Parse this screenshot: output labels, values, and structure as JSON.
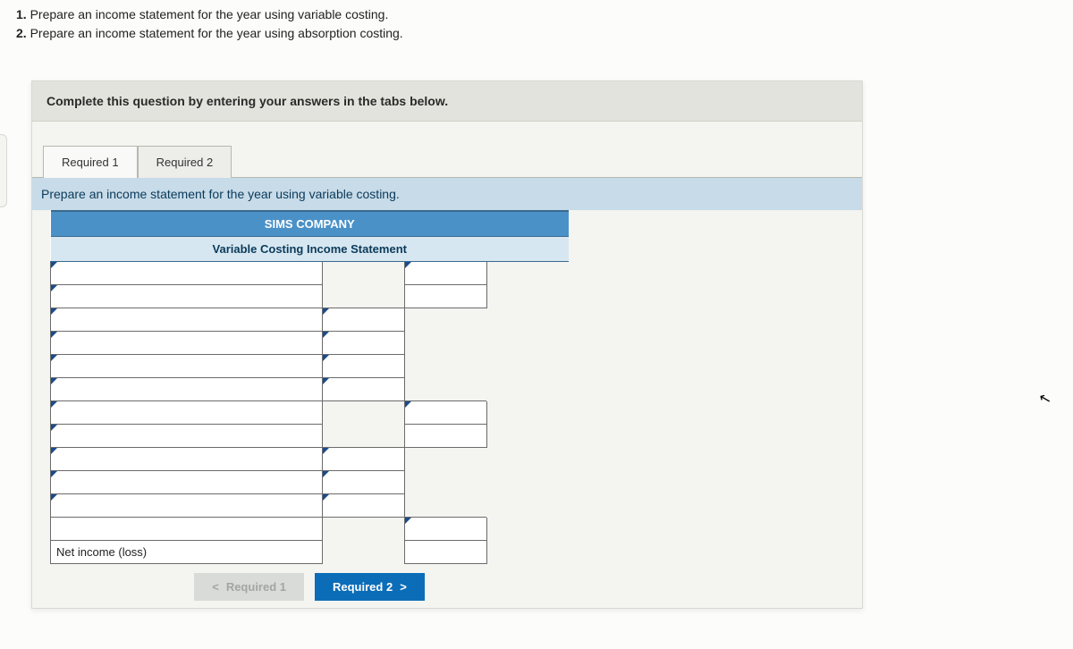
{
  "instructions": {
    "line1_num": "1.",
    "line1_text": " Prepare an income statement for the year using variable costing.",
    "line2_num": "2.",
    "line2_text": " Prepare an income statement for the year using absorption costing."
  },
  "panel": {
    "header": "Complete this question by entering your answers in the tabs below."
  },
  "tabs": {
    "t1": "Required 1",
    "t2": "Required 2"
  },
  "subprompt": "Prepare an income statement for the year using variable costing.",
  "sheet": {
    "company": "SIMS COMPANY",
    "title": "Variable Costing Income Statement",
    "net_income_label": "Net income (loss)"
  },
  "nav": {
    "prev_label": "Required 1",
    "next_label": "Required 2",
    "chev_left": "<",
    "chev_right": ">"
  }
}
